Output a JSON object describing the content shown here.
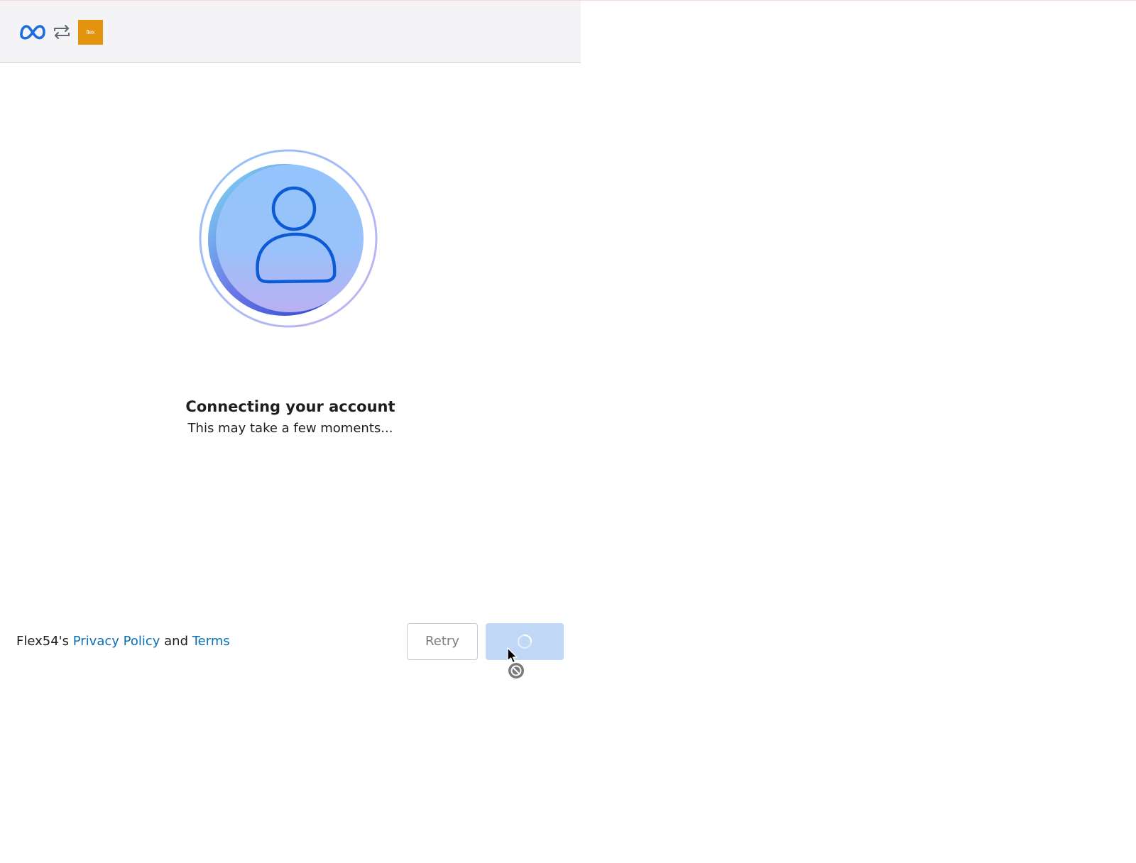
{
  "header": {
    "meta_logo_icon": "meta-infinity-logo",
    "swap_icon": "arrows-swap-icon",
    "app_logo_text": "flex",
    "app_logo_color": "#e3930e"
  },
  "main": {
    "avatar_icon": "user-avatar-icon",
    "title": "Connecting your account",
    "subtitle": "This may take a few moments..."
  },
  "footer": {
    "owner": "Flex54's",
    "privacy_link": "Privacy Policy",
    "and_text": "and",
    "terms_link": "Terms",
    "link_color": "#0a6fb5"
  },
  "buttons": {
    "retry_label": "Retry",
    "continue_state": "loading",
    "continue_color": "#c0d8f5"
  },
  "cursor": {
    "icon": "not-allowed-cursor-icon"
  }
}
